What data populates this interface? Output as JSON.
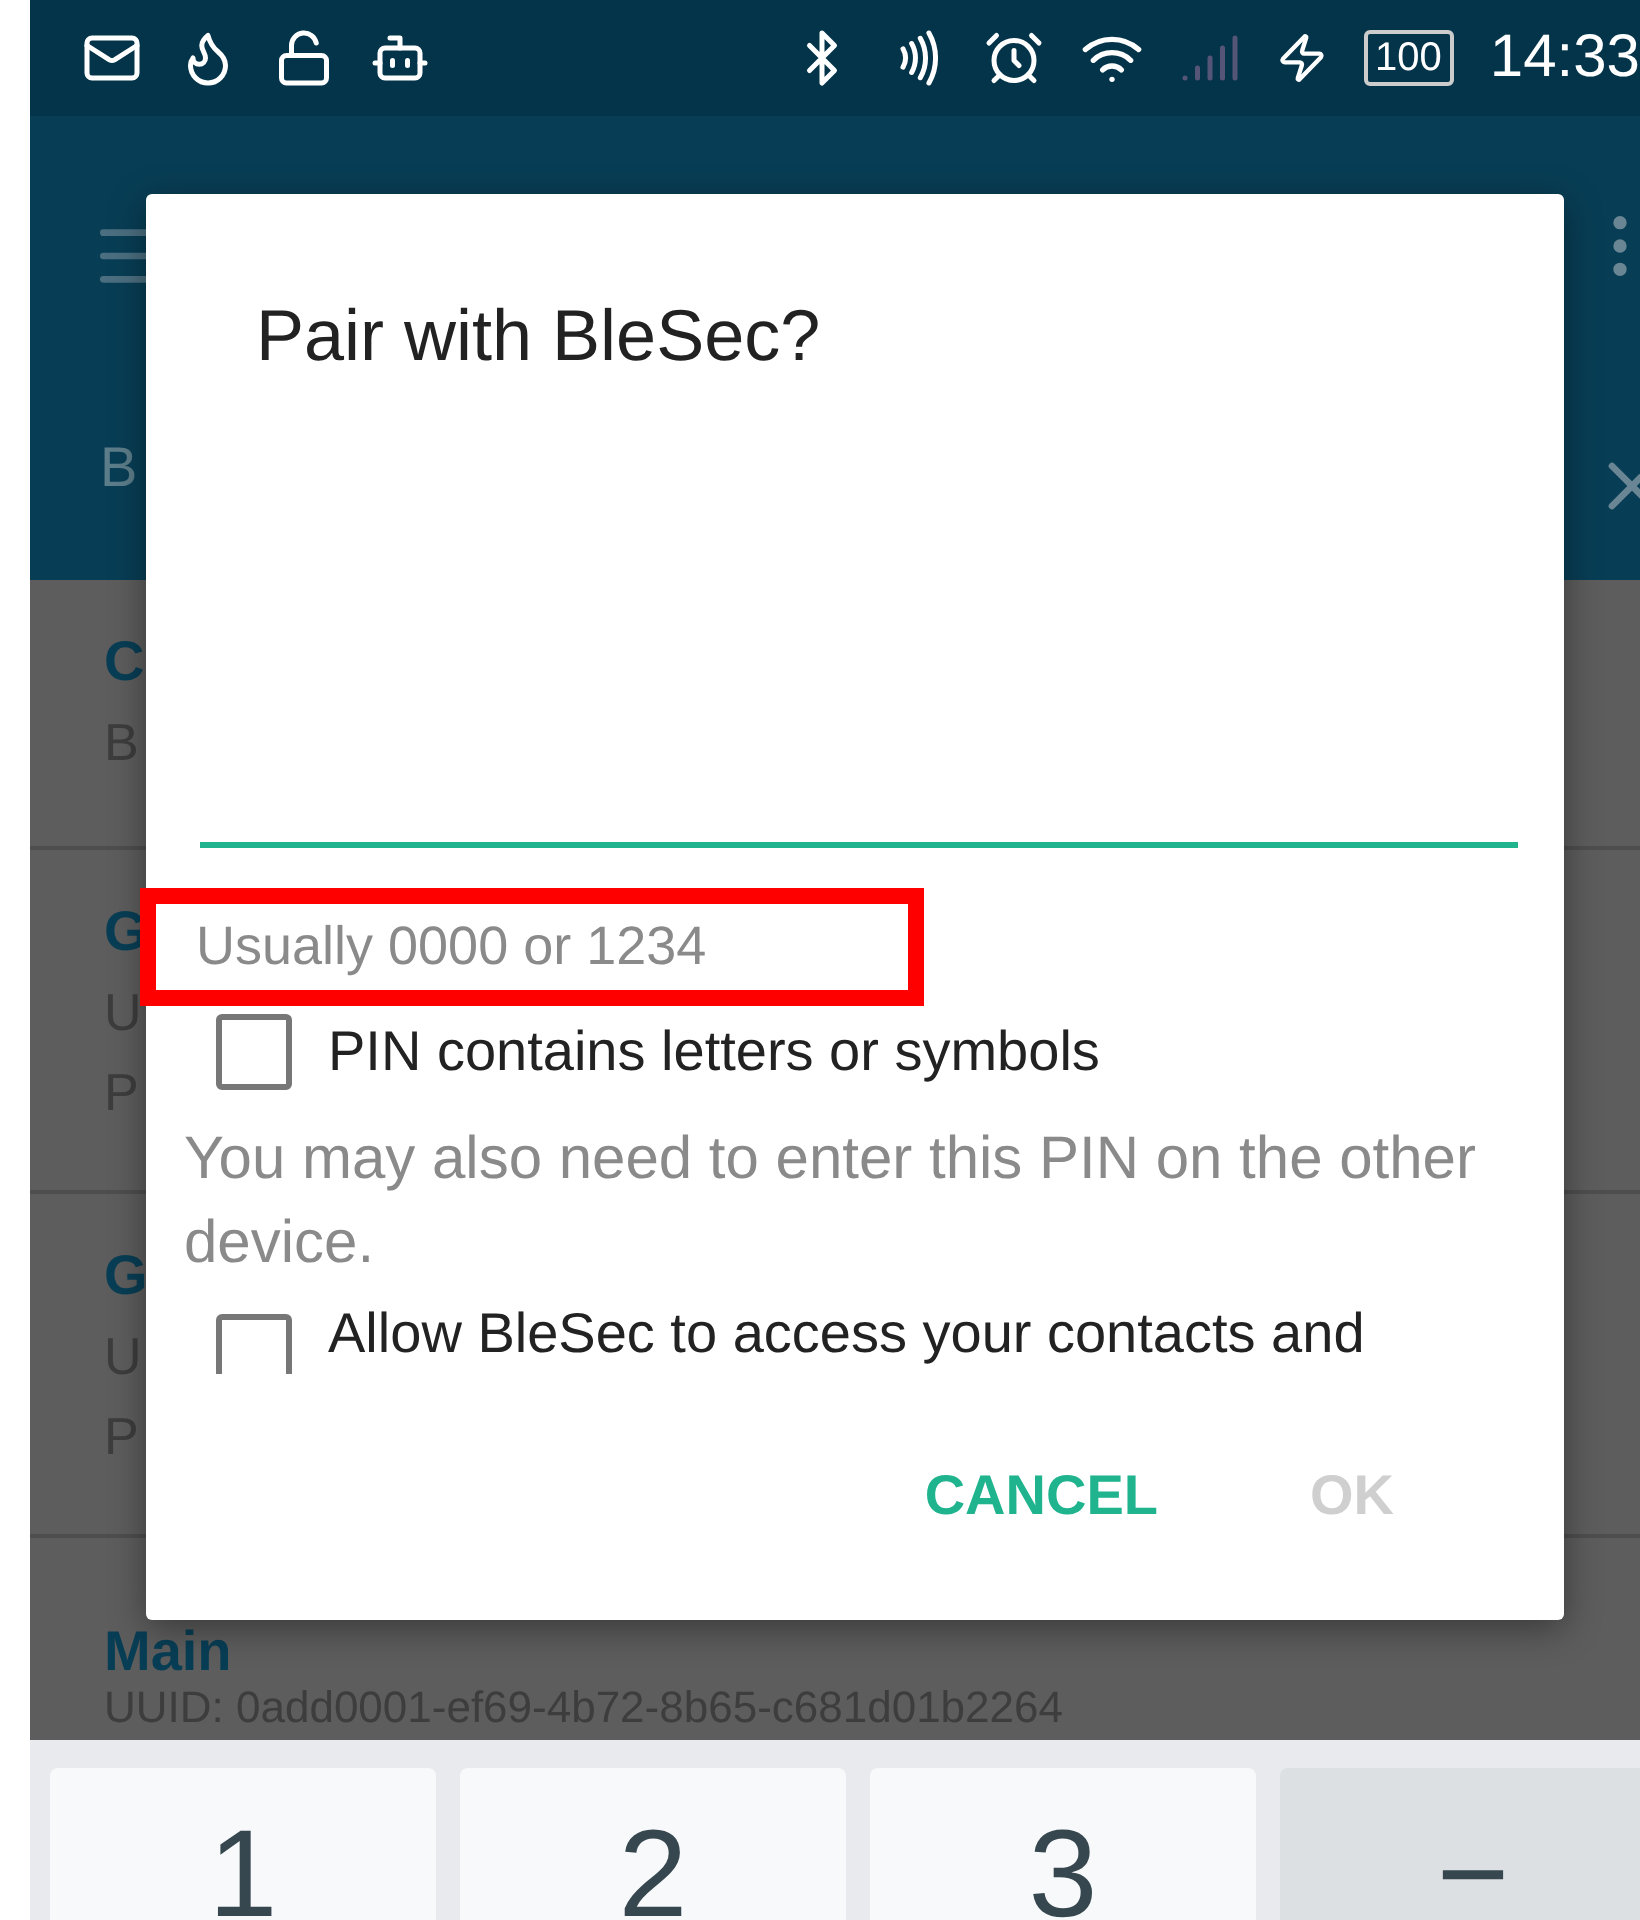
{
  "status_bar": {
    "battery": "100",
    "time": "14:33"
  },
  "app_bar": {
    "tab_fragment": "B"
  },
  "list_rows": [
    {
      "lines": [
        "C",
        "B"
      ]
    },
    {
      "lines": [
        "G",
        "U",
        "P"
      ]
    },
    {
      "lines": [
        "G",
        "U",
        "P"
      ]
    },
    {
      "lines": [
        "Main",
        "UUID: 0add0001-ef69-4b72-8b65-c681d01b2264"
      ]
    }
  ],
  "dialog": {
    "title": "Pair with BleSec?",
    "helper": "Usually 0000 or 1234",
    "highlighted": true,
    "options": [
      {
        "label": "PIN contains letters or symbols",
        "checked": false
      }
    ],
    "note": "You may also need to enter this PIN on the other device.",
    "permission": {
      "label": "Allow BleSec to access your contacts and",
      "checked": false
    },
    "buttons": [
      {
        "label": "CANCEL",
        "disabled": false
      },
      {
        "label": "OK",
        "disabled": true
      }
    ]
  },
  "keyboard": {
    "keys": [
      {
        "label": "1",
        "kind": "digit"
      },
      {
        "label": "2",
        "kind": "digit"
      },
      {
        "label": "3",
        "kind": "digit"
      },
      {
        "label": "−",
        "kind": "symbol"
      }
    ]
  }
}
